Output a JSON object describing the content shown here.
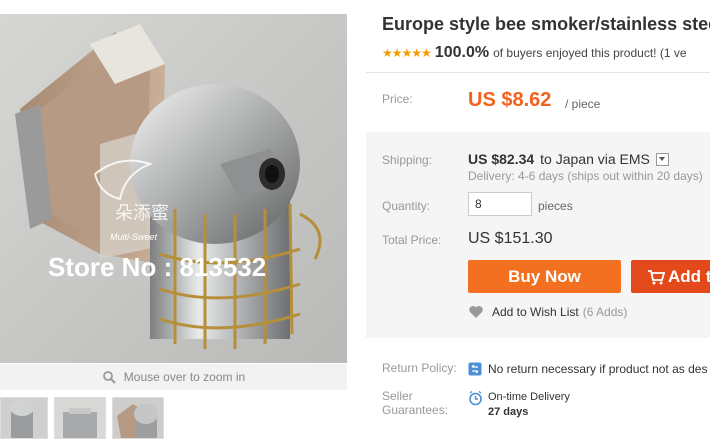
{
  "product": {
    "title": "Europe style bee smoker/stainless steel b",
    "rating_stars": "★★★★★",
    "rating_percent": "100.0%",
    "rating_text": "of buyers enjoyed this product! (1 ve"
  },
  "image": {
    "watermark_store": "Store No : 813532",
    "watermark_brand": "Multi-Sweet",
    "zoom_hint": "Mouse over to zoom in"
  },
  "labels": {
    "price": "Price:",
    "shipping": "Shipping:",
    "quantity": "Quantity:",
    "total_price": "Total Price:",
    "return_policy": "Return Policy:",
    "seller_guarantees_1": "Seller",
    "seller_guarantees_2": "Guarantees:"
  },
  "price": {
    "value": "US $8.62",
    "unit": "/ piece"
  },
  "shipping": {
    "cost": "US $82.34",
    "destination": "to  Japan via EMS",
    "delivery": "Delivery: 4-6 days (ships out within 20 days)"
  },
  "quantity": {
    "value": "8",
    "unit": "pieces"
  },
  "total": "US $151.30",
  "buttons": {
    "buy_now": "Buy Now",
    "add_to_cart": "Add t"
  },
  "wishlist": {
    "label": "Add to Wish List",
    "count": "(6 Adds)"
  },
  "return_policy": "No return necessary if product not as des",
  "guarantee": {
    "line1": "On-time Delivery",
    "line2": "27 days"
  },
  "colors": {
    "price_orange": "#f2611d",
    "buy_now": "#f37021",
    "add_to_cart": "#e4491c",
    "stars": "#f59a00"
  }
}
